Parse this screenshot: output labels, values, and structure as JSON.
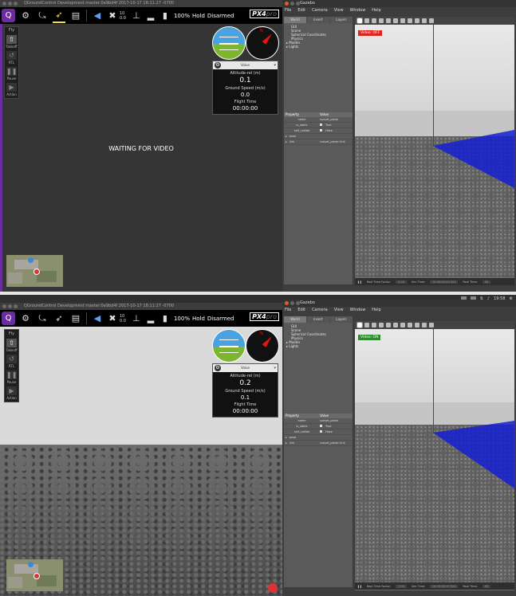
{
  "top": {
    "qgc": {
      "title": "QGroundControl Development master:0a9bd4f 2017-10-17 18:11:27 -0700",
      "battery": "100%",
      "flight_mode": "Hold",
      "arm_state": "Disarmed",
      "gps_count": "10",
      "hdop": "0.0",
      "logo_text": "PX4",
      "logo_suffix": "pro",
      "tools": [
        {
          "label": "Fly"
        },
        {
          "label": "Takeoff"
        },
        {
          "label": "RTL"
        },
        {
          "label": "Pause"
        },
        {
          "label": "Action"
        }
      ],
      "panel_header": "Value",
      "values": [
        {
          "label": "Altitude-rel (m)",
          "value": "0.1"
        },
        {
          "label": "Ground Speed (m/s)",
          "value": "0.0"
        },
        {
          "label": "Flight Time",
          "value": "00:00:00"
        }
      ],
      "video_message": "WAITING FOR VIDEO"
    },
    "gazebo": {
      "title": "Gazebo",
      "menu": [
        "File",
        "Edit",
        "Camera",
        "View",
        "Window",
        "Help"
      ],
      "tabs": [
        "World",
        "Insert",
        "Layers"
      ],
      "tree": [
        "GUI",
        "Scene",
        "Spherical Coordinates",
        "Physics",
        "Models",
        "Lights"
      ],
      "props_header": [
        "Property",
        "Value"
      ],
      "props": [
        {
          "k": "name",
          "v": "sunset_plane"
        },
        {
          "k": "is_static",
          "v": "True"
        },
        {
          "k": "self_collide",
          "v": "False"
        },
        {
          "k": "pose",
          "v": ""
        },
        {
          "k": "link",
          "v": "sunset_plane::link"
        }
      ],
      "video_badge": "Video: OFF",
      "video_badge_color": "#e0231b",
      "status": {
        "rtf_label": "Real Time Factor:",
        "rtf": "0.00",
        "sim_label": "Sim Time:",
        "sim": "00 00:02:53.424",
        "real_label": "Real Time:",
        "real": "00"
      }
    }
  },
  "bottom": {
    "topbar": {
      "time": "19:58"
    },
    "qgc": {
      "title": "QGroundControl Development master:0a9bd4f 2017-10-17 18:11:27 -0700",
      "battery": "100%",
      "flight_mode": "Hold",
      "arm_state": "Disarmed",
      "gps_count": "10",
      "hdop": "0.0",
      "logo_text": "PX4",
      "logo_suffix": "pro",
      "tools": [
        {
          "label": "Fly"
        },
        {
          "label": "Takeoff"
        },
        {
          "label": "RTL"
        },
        {
          "label": "Pause"
        },
        {
          "label": "Action"
        }
      ],
      "panel_header": "Value",
      "values": [
        {
          "label": "Altitude-rel (m)",
          "value": "0.2"
        },
        {
          "label": "Ground Speed (m/s)",
          "value": "0.1"
        },
        {
          "label": "Flight Time",
          "value": "00:00:00"
        }
      ]
    },
    "gazebo": {
      "title": "Gazebo",
      "menu": [
        "File",
        "Edit",
        "Camera",
        "View",
        "Window",
        "Help"
      ],
      "tabs": [
        "World",
        "Insert",
        "Layers"
      ],
      "tree": [
        "GUI",
        "Scene",
        "Spherical Coordinates",
        "Physics",
        "Models",
        "Lights"
      ],
      "props_header": [
        "Property",
        "Value"
      ],
      "props": [
        {
          "k": "name",
          "v": "sunset_plane"
        },
        {
          "k": "is_static",
          "v": "True"
        },
        {
          "k": "self_collide",
          "v": "False"
        },
        {
          "k": "pose",
          "v": ""
        },
        {
          "k": "link",
          "v": "sunset_plane::link"
        }
      ],
      "video_badge": "Video: ON",
      "video_badge_color": "#2e8b2e",
      "status": {
        "rtf_label": "Real Time Factor:",
        "rtf": "1.00",
        "sim_label": "Sim Time:",
        "sim": "00 00:03:17.524",
        "real_label": "Real Time:",
        "real": "00"
      }
    }
  },
  "icons": {
    "qgc_logo": "qgc-logo-icon",
    "vehicle_setup": "gears-icon",
    "plan_flight": "plan-icon",
    "fly": "paper-plane-icon",
    "analyze": "document-search-icon",
    "messages": "megaphone-icon",
    "gps": "satellite-icon",
    "rc": "rc-signal-icon",
    "battery": "battery-icon"
  }
}
